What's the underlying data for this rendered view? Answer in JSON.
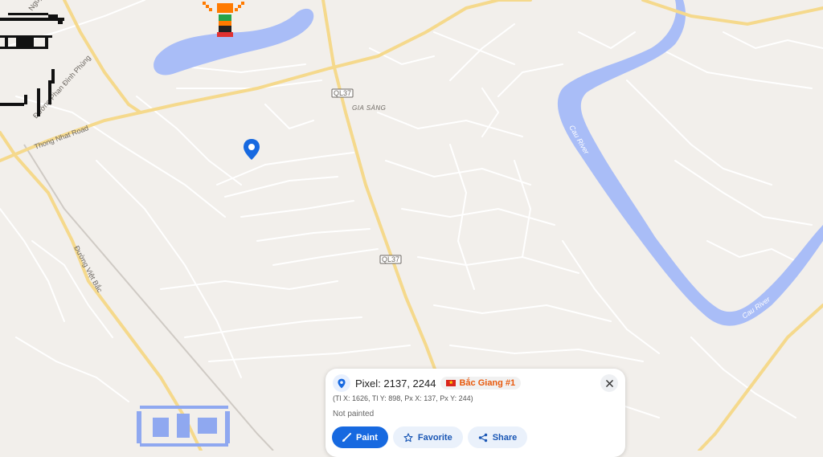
{
  "map": {
    "road_labels": {
      "ql37_top": "QL37",
      "ql37_mid": "QL37",
      "thong_nhat": "Thong Nhat Road",
      "phan_dinh_phung": "Đường Phan Đình Phùng",
      "viet_bac": "Đường Việt Bắc",
      "nguyen_top": "Nguyễn"
    },
    "place_labels": {
      "gia_sang": "GIA SÀNG"
    },
    "river_labels": {
      "cau_upper": "Cau River",
      "cau_lower": "Cau River"
    },
    "colors": {
      "land": "#f2efeb",
      "water": "#a9bdf7",
      "major_road": "#f5d98c",
      "minor_road": "#ffffff",
      "pin": "#1769e0"
    }
  },
  "panel": {
    "pixel_title": "Pixel: 2137, 2244",
    "region_badge": "Bắc Giang #1",
    "coords": "(Tl X: 1626, Tl Y: 898, Px X: 137, Px Y: 244)",
    "status": "Not painted",
    "paint_label": "Paint",
    "favorite_label": "Favorite",
    "share_label": "Share",
    "close_icon": "close-icon"
  }
}
